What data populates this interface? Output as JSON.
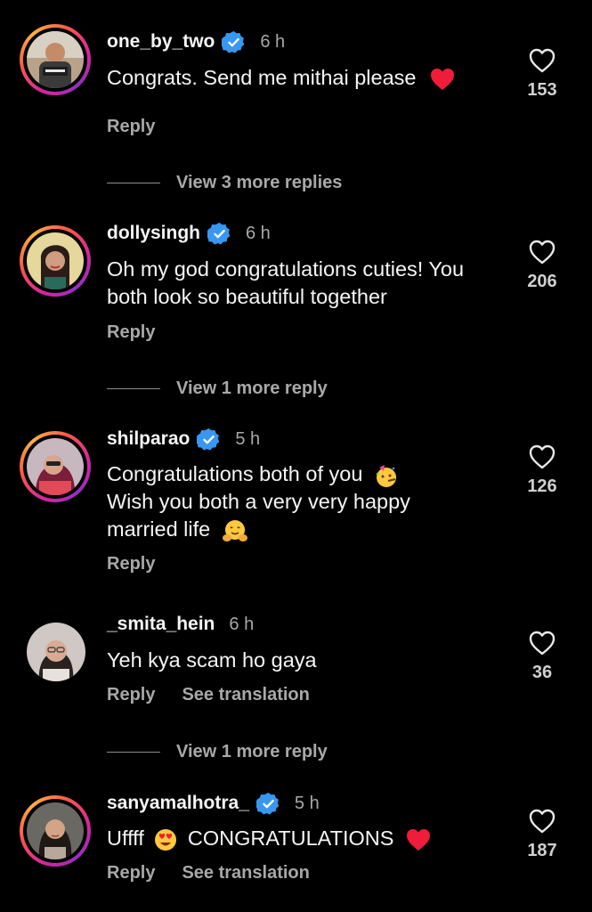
{
  "comments": [
    {
      "username": "one_by_two",
      "verified": true,
      "time": "6 h",
      "text": "Congrats. Send me mithai please",
      "emoji_end": "heart-emoji",
      "likes": "153",
      "actions": {
        "reply": "Reply"
      },
      "view_more": "View 3 more replies"
    },
    {
      "username": "dollysingh",
      "verified": true,
      "time": "6 h",
      "text": "Oh my god congratulations cuties! You both look so beautiful together",
      "likes": "206",
      "actions": {
        "reply": "Reply"
      },
      "view_more": "View 1 more reply"
    },
    {
      "username": "shilparao",
      "verified": true,
      "time": "5 h",
      "line1": "Congratulations both of you",
      "line2": "Wish you both a very very happy",
      "line3": "married life",
      "likes": "126",
      "actions": {
        "reply": "Reply"
      }
    },
    {
      "username": "_smita_hein",
      "verified": false,
      "time": "6 h",
      "text": "Yeh kya scam ho gaya",
      "likes": "36",
      "actions": {
        "reply": "Reply",
        "see_translation": "See translation"
      },
      "view_more": "View 1 more reply"
    },
    {
      "username": "sanyamalhotra_",
      "verified": true,
      "time": "5 h",
      "text_pre": "Uffff",
      "text_post": "CONGRATULATIONS",
      "likes": "187",
      "actions": {
        "reply": "Reply",
        "see_translation": "See translation"
      }
    }
  ],
  "colors": {
    "background": "#000000",
    "verified_badge": "#3897f0",
    "secondary_text": "#a8a8a8"
  }
}
